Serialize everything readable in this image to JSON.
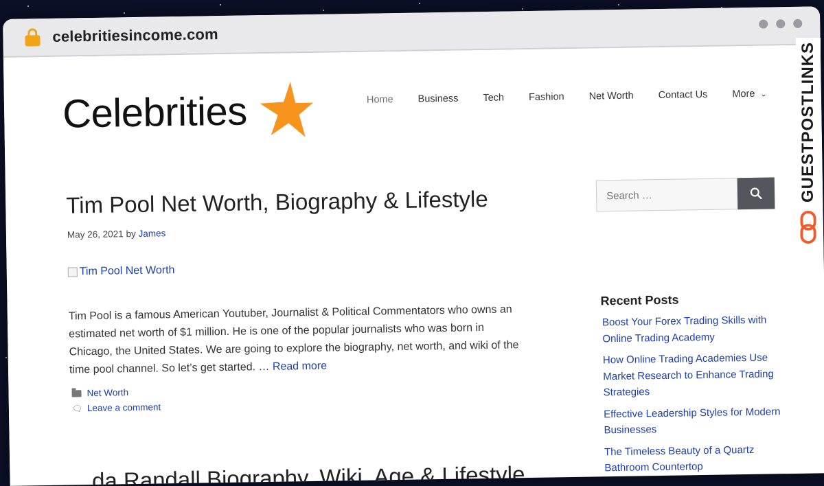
{
  "browser": {
    "url": "celebritiesincome.com"
  },
  "site": {
    "logo_text": "Celebrities"
  },
  "nav": {
    "items": [
      "Home",
      "Business",
      "Tech",
      "Fashion",
      "Net Worth",
      "Contact Us",
      "More"
    ],
    "active": "Home"
  },
  "post": {
    "title": "Tim Pool Net Worth, Biography & Lifestyle",
    "date": "May 26, 2021",
    "by": "by",
    "author": "James",
    "image_alt": "Tim Pool Net Worth",
    "excerpt": "Tim Pool is a famous American Youtuber, Journalist & Political Commentators who owns an estimated net worth of $1 million. He is one of the popular journalists who was born in Chicago, the United States. We are going to explore the biography, net worth, and wiki of the time pool channel. So let’s get started. …",
    "read_more": "Read more",
    "category": "Net Worth",
    "comment_link": "Leave a comment"
  },
  "next_post": {
    "title": "...da Randall Biography, Wiki, Age & Lifestyle"
  },
  "sidebar": {
    "search_placeholder": "Search …",
    "recent_heading": "Recent Posts",
    "recent_posts": [
      "Boost Your Forex Trading Skills with Online Trading Academy",
      "How Online Trading Academies Use Market Research to Enhance Trading Strategies",
      "Effective Leadership Styles for Modern Businesses",
      "The Timeless Beauty of a Quartz Bathroom Countertop"
    ]
  },
  "watermark": {
    "text": "GUESTPOSTLINKS"
  },
  "colors": {
    "accent": "#f7941d",
    "link": "#1e3fa8",
    "lock": "#f2a417"
  }
}
